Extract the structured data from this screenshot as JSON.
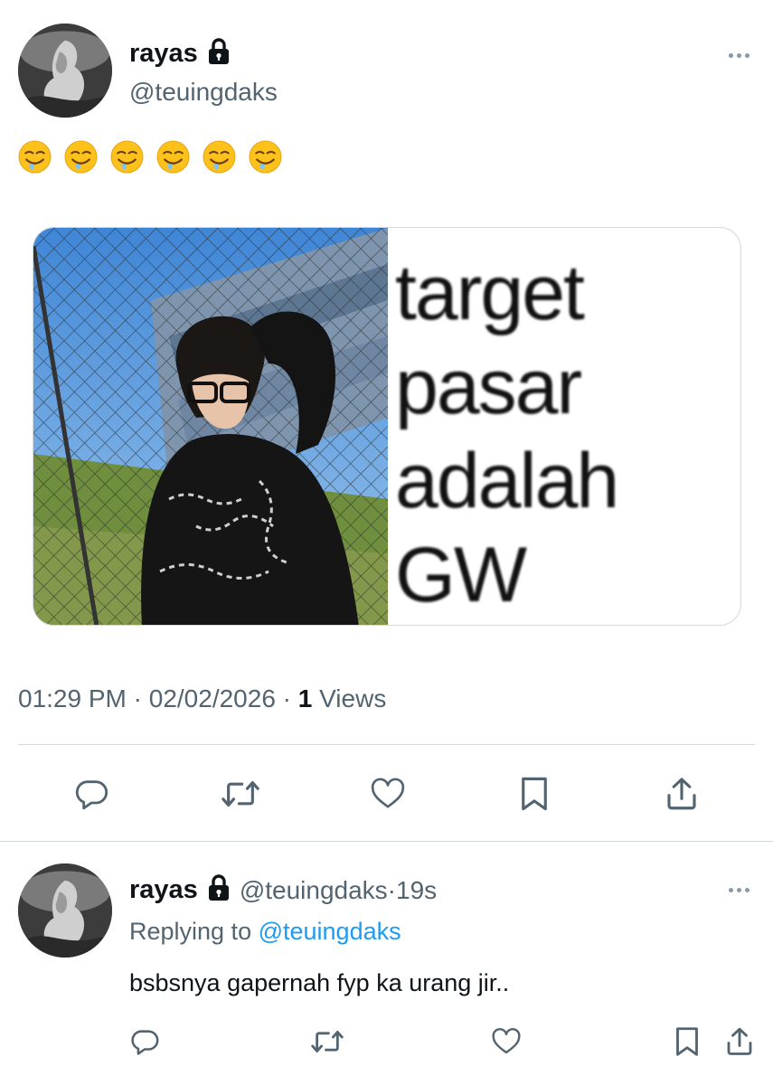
{
  "tweet": {
    "author": {
      "display_name": "rayas",
      "handle": "@teuingdaks",
      "avatar_icon": "avatar-photo",
      "protected_icon": "lock-icon"
    },
    "text_emojis": [
      "🤤",
      "🤤",
      "🤤",
      "🤤",
      "🤤",
      "🤤"
    ],
    "media": {
      "meme_lines": [
        "target",
        "pasar",
        "adalah",
        "GW"
      ]
    },
    "meta": {
      "time": "01:29 PM",
      "separator": " · ",
      "date": "02/02/2026",
      "views_count": "1",
      "views_label": "Views"
    },
    "actions": [
      {
        "name": "reply",
        "icon": "reply-icon"
      },
      {
        "name": "repost",
        "icon": "repost-icon"
      },
      {
        "name": "like",
        "icon": "heart-icon"
      },
      {
        "name": "bookmark",
        "icon": "bookmark-icon"
      },
      {
        "name": "share",
        "icon": "share-icon"
      }
    ]
  },
  "reply": {
    "author": {
      "display_name": "rayas",
      "handle": "@teuingdaks",
      "time_sep": " · ",
      "time": "19s"
    },
    "replying_prefix": "Replying to ",
    "replying_handle": "@teuingdaks",
    "text": "bsbsnya gapernah fyp ka urang jir.."
  },
  "colors": {
    "accent": "#1d9bf0",
    "secondary_text": "#536471",
    "primary_text": "#0f1419",
    "divider": "#cfd9de"
  }
}
